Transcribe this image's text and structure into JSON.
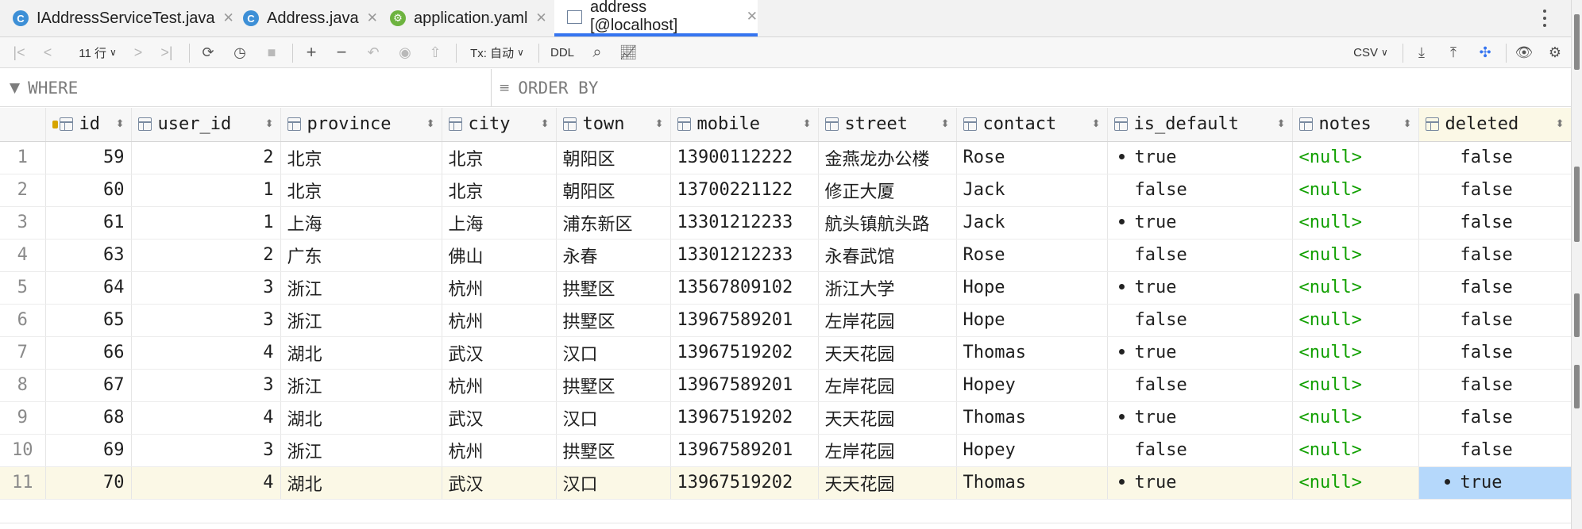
{
  "tabs": [
    {
      "label": "IAddressServiceTest.java",
      "icon": "java-class-icon",
      "active": false
    },
    {
      "label": "Address.java",
      "icon": "java-class-icon",
      "active": false
    },
    {
      "label": "application.yaml",
      "icon": "spring-yaml-icon",
      "active": false
    },
    {
      "label": "address [@localhost]",
      "icon": "table-icon",
      "active": true
    }
  ],
  "toolbar": {
    "rows_label": "11 行",
    "tx_label": "Tx: 自动",
    "ddl_label": "DDL",
    "export_format": "CSV"
  },
  "filter": {
    "where_placeholder": "WHERE",
    "orderby_placeholder": "ORDER BY"
  },
  "columns": [
    "id",
    "user_id",
    "province",
    "city",
    "town",
    "mobile",
    "street",
    "contact",
    "is_default",
    "notes",
    "deleted"
  ],
  "rows": [
    {
      "n": "1",
      "id": "59",
      "user_id": "2",
      "province": "北京",
      "city": "北京",
      "town": "朝阳区",
      "mobile": "13900112222",
      "street": "金燕龙办公楼",
      "contact": "Rose",
      "is_default": "true",
      "notes": "<null>",
      "deleted": "false"
    },
    {
      "n": "2",
      "id": "60",
      "user_id": "1",
      "province": "北京",
      "city": "北京",
      "town": "朝阳区",
      "mobile": "13700221122",
      "street": "修正大厦",
      "contact": "Jack",
      "is_default": "false",
      "notes": "<null>",
      "deleted": "false"
    },
    {
      "n": "3",
      "id": "61",
      "user_id": "1",
      "province": "上海",
      "city": "上海",
      "town": "浦东新区",
      "mobile": "13301212233",
      "street": "航头镇航头路",
      "contact": "Jack",
      "is_default": "true",
      "notes": "<null>",
      "deleted": "false"
    },
    {
      "n": "4",
      "id": "63",
      "user_id": "2",
      "province": "广东",
      "city": "佛山",
      "town": "永春",
      "mobile": "13301212233",
      "street": "永春武馆",
      "contact": "Rose",
      "is_default": "false",
      "notes": "<null>",
      "deleted": "false"
    },
    {
      "n": "5",
      "id": "64",
      "user_id": "3",
      "province": "浙江",
      "city": "杭州",
      "town": "拱墅区",
      "mobile": "13567809102",
      "street": "浙江大学",
      "contact": "Hope",
      "is_default": "true",
      "notes": "<null>",
      "deleted": "false"
    },
    {
      "n": "6",
      "id": "65",
      "user_id": "3",
      "province": "浙江",
      "city": "杭州",
      "town": "拱墅区",
      "mobile": "13967589201",
      "street": "左岸花园",
      "contact": "Hope",
      "is_default": "false",
      "notes": "<null>",
      "deleted": "false"
    },
    {
      "n": "7",
      "id": "66",
      "user_id": "4",
      "province": "湖北",
      "city": "武汉",
      "town": "汉口",
      "mobile": "13967519202",
      "street": "天天花园",
      "contact": "Thomas",
      "is_default": "true",
      "notes": "<null>",
      "deleted": "false"
    },
    {
      "n": "8",
      "id": "67",
      "user_id": "3",
      "province": "浙江",
      "city": "杭州",
      "town": "拱墅区",
      "mobile": "13967589201",
      "street": "左岸花园",
      "contact": "Hopey",
      "is_default": "false",
      "notes": "<null>",
      "deleted": "false"
    },
    {
      "n": "9",
      "id": "68",
      "user_id": "4",
      "province": "湖北",
      "city": "武汉",
      "town": "汉口",
      "mobile": "13967519202",
      "street": "天天花园",
      "contact": "Thomas",
      "is_default": "true",
      "notes": "<null>",
      "deleted": "false"
    },
    {
      "n": "10",
      "id": "69",
      "user_id": "3",
      "province": "浙江",
      "city": "杭州",
      "town": "拱墅区",
      "mobile": "13967589201",
      "street": "左岸花园",
      "contact": "Hopey",
      "is_default": "false",
      "notes": "<null>",
      "deleted": "false"
    },
    {
      "n": "11",
      "id": "70",
      "user_id": "4",
      "province": "湖北",
      "city": "武汉",
      "town": "汉口",
      "mobile": "13967519202",
      "street": "天天花园",
      "contact": "Thomas",
      "is_default": "true",
      "notes": "<null>",
      "deleted": "true"
    }
  ],
  "colors": {
    "accent": "#3574f0",
    "null_text": "#11a000",
    "selected_row": "#fbf8e6",
    "selected_cell": "#b5d8fb"
  }
}
